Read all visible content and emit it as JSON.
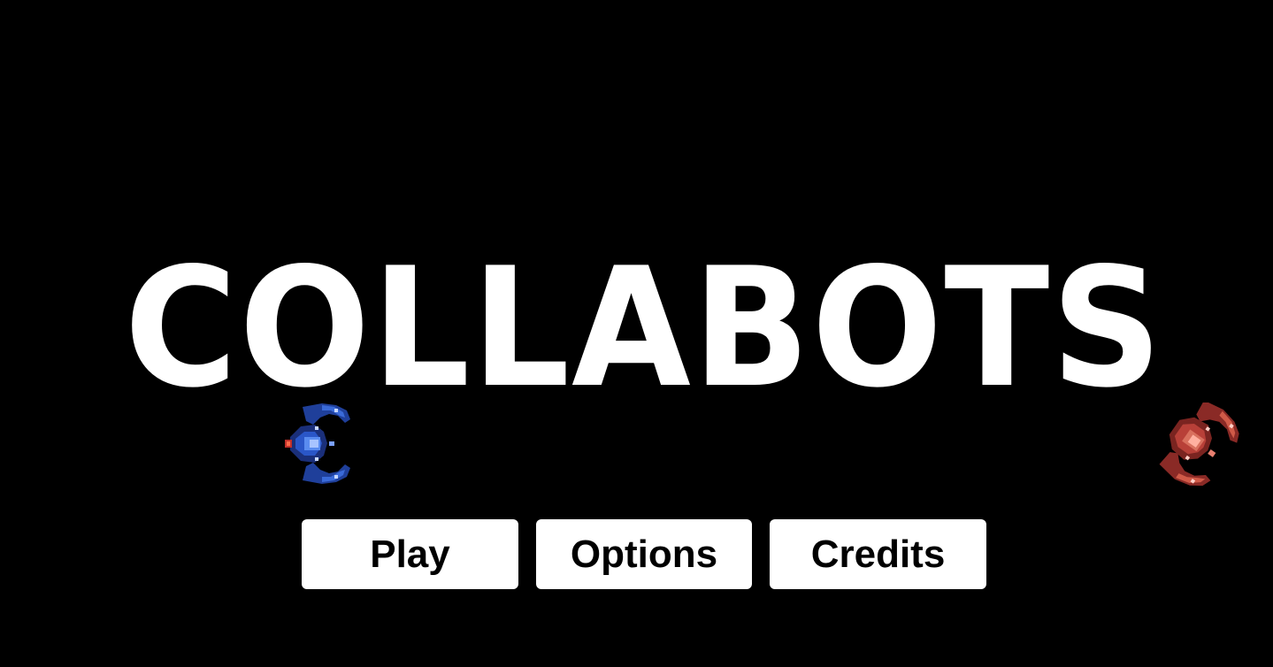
{
  "game": {
    "title": "COLLABOTS"
  },
  "menu": {
    "buttons": [
      {
        "label": "Play"
      },
      {
        "label": "Options"
      },
      {
        "label": "Credits"
      }
    ]
  },
  "sprites": {
    "player_ship": "blue-spaceship-sprite",
    "enemy_ship": "red-spaceship-sprite"
  },
  "colors": {
    "background": "#000000",
    "title": "#ffffff",
    "button_bg": "#ffffff",
    "button_text": "#000000",
    "player_ship": "#1f4fb8",
    "enemy_ship": "#b8403a"
  }
}
